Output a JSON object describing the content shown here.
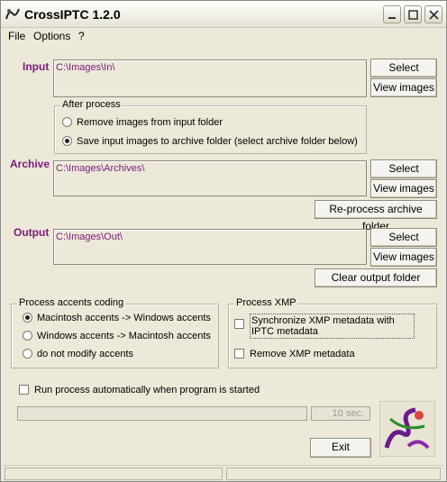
{
  "window": {
    "title": "CrossIPTC 1.2.0"
  },
  "menu": [
    {
      "label": "File"
    },
    {
      "label": "Options"
    },
    {
      "label": "?"
    }
  ],
  "input": {
    "label": "Input",
    "path": "C:\\Images\\In\\",
    "select_label": "Select",
    "view_label": "View images"
  },
  "after_process": {
    "title": "After process",
    "options": [
      {
        "label": "Remove images from input folder",
        "selected": false
      },
      {
        "label": "Save input images to archive folder (select archive folder below)",
        "selected": true
      }
    ]
  },
  "archive": {
    "label": "Archive",
    "path": "C:\\Images\\Archives\\",
    "select_label": "Select",
    "view_label": "View images",
    "reprocess_label": "Re-process archive folder"
  },
  "output": {
    "label": "Output",
    "path": "C:\\Images\\Out\\",
    "select_label": "Select",
    "view_label": "View images",
    "clear_label": "Clear output folder"
  },
  "accents": {
    "title": "Process accents coding",
    "options": [
      {
        "label": "Macintosh accents -> Windows accents",
        "selected": true
      },
      {
        "label": "Windows accents -> Macintosh accents",
        "selected": false
      },
      {
        "label": "do not modify accents",
        "selected": false
      }
    ]
  },
  "xmp": {
    "title": "Process XMP",
    "sync_label": "Synchronize XMP metadata with IPTC metadata",
    "sync_checked": false,
    "remove_label": "Remove XMP metadata",
    "remove_checked": false
  },
  "auto_run": {
    "label": "Run process automatically when program is started",
    "checked": false
  },
  "timer": {
    "text": "10 sec."
  },
  "exit_label": "Exit"
}
